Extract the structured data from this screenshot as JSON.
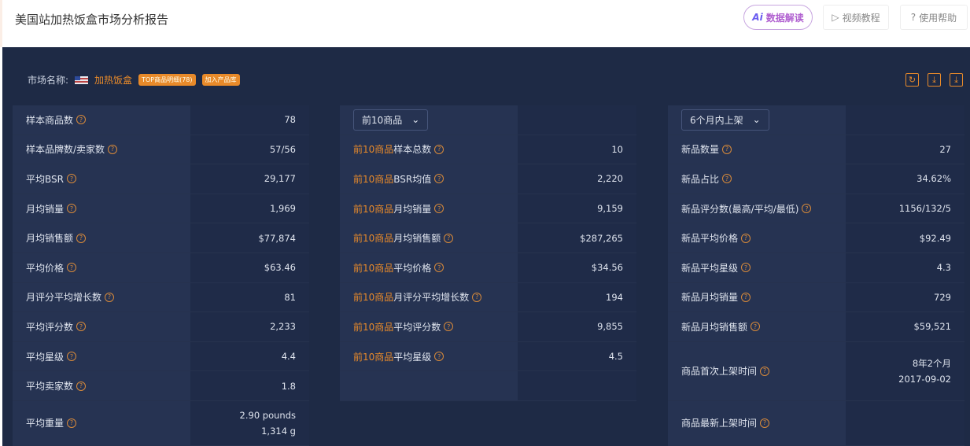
{
  "header": {
    "title": "美国站加热饭盒市场分析报告",
    "ai_prefix": "Ai",
    "ai_label": "数据解读",
    "video_label": "视频教程",
    "help_label": "使用帮助"
  },
  "market": {
    "label": "市场名称:",
    "name": "加热饭盒",
    "top_tag": "TOP商品明细(78)",
    "add_tag": "加入产品库"
  },
  "col1": [
    {
      "label": "样本商品数",
      "value": "78"
    },
    {
      "label": "样本品牌数/卖家数",
      "value": "57/56"
    },
    {
      "label": "平均BSR",
      "value": "29,177"
    },
    {
      "label": "月均销量",
      "value": "1,969"
    },
    {
      "label": "月均销售额",
      "value": "$77,874"
    },
    {
      "label": "平均价格",
      "value": "$63.46"
    },
    {
      "label": "月评分平均增长数",
      "value": "81"
    },
    {
      "label": "平均评分数",
      "value": "2,233"
    },
    {
      "label": "平均星级",
      "value": "4.4"
    },
    {
      "label": "平均卖家数",
      "value": "1.8"
    },
    {
      "label": "平均重量",
      "value": "2.90 pounds",
      "value2": "1,314 g"
    }
  ],
  "col2": {
    "select": "前10商品",
    "prefix": "前10商品",
    "rows": [
      {
        "label": "样本总数",
        "value": "10"
      },
      {
        "label": "BSR均值",
        "value": "2,220"
      },
      {
        "label": "月均销量",
        "value": "9,159"
      },
      {
        "label": "月均销售额",
        "value": "$287,265"
      },
      {
        "label": "平均价格",
        "value": "$34.56"
      },
      {
        "label": "月评分平均增长数",
        "value": "194"
      },
      {
        "label": "平均评分数",
        "value": "9,855"
      },
      {
        "label": "平均星级",
        "value": "4.5"
      }
    ]
  },
  "col3": {
    "select": "6个月内上架",
    "rows": [
      {
        "label": "新品数量",
        "value": "27"
      },
      {
        "label": "新品占比",
        "value": "34.62%"
      },
      {
        "label": "新品评分数(最高/平均/最低)",
        "value": "1156/132/5"
      },
      {
        "label": "新品平均价格",
        "value": "$92.49"
      },
      {
        "label": "新品平均星级",
        "value": "4.3"
      },
      {
        "label": "新品月均销量",
        "value": "729"
      },
      {
        "label": "新品月均销售额",
        "value": "$59,521"
      }
    ],
    "first_listed": {
      "label": "商品首次上架时间",
      "value": "8年2个月",
      "value2": "2017-09-02"
    },
    "latest_listed": {
      "label": "商品最新上架时间"
    }
  }
}
